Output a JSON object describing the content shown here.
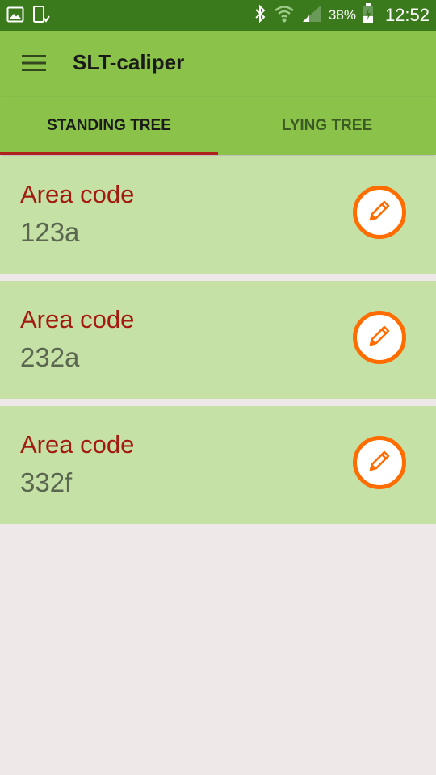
{
  "status_bar": {
    "battery": "38%",
    "time": "12:52"
  },
  "app_bar": {
    "title": "SLT-caliper"
  },
  "tabs": [
    {
      "label": "STANDING TREE",
      "active": true
    },
    {
      "label": "LYING TREE",
      "active": false
    }
  ],
  "items": [
    {
      "label": "Area code",
      "value": "123a"
    },
    {
      "label": "Area code",
      "value": "232a"
    },
    {
      "label": "Area code",
      "value": "332f"
    }
  ],
  "colors": {
    "status_bar": "#3a7a1c",
    "app_bar": "#8bc34a",
    "card": "#c5e1a5",
    "label_red": "#a31a10",
    "accent_orange": "#ff6d00",
    "tab_indicator": "#b0231c"
  }
}
